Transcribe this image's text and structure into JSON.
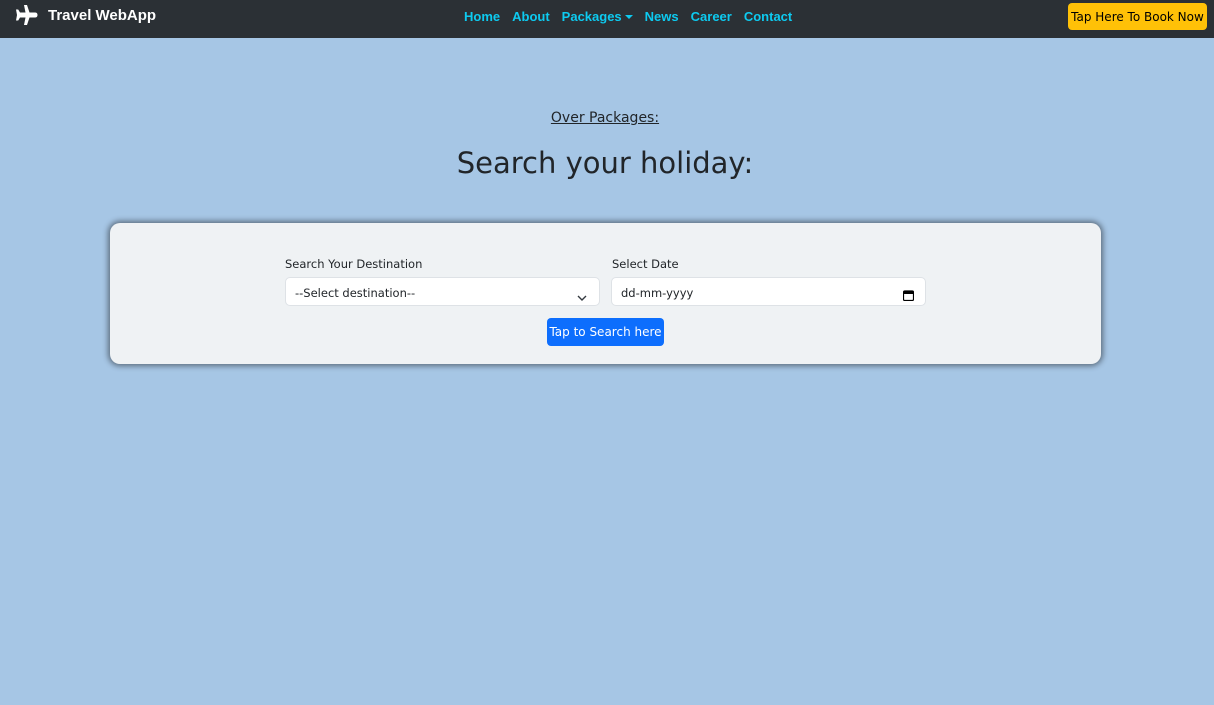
{
  "navbar": {
    "brand": "Travel WebApp",
    "brand_icon": "airplane-icon",
    "links": [
      {
        "label": "Home"
      },
      {
        "label": "About"
      },
      {
        "label": "Packages",
        "dropdown": true
      },
      {
        "label": "News"
      },
      {
        "label": "Career"
      },
      {
        "label": "Contact"
      }
    ],
    "book_button": "Tap Here To Book Now"
  },
  "main": {
    "subheading": "Over Packages:",
    "heading": "Search your holiday:"
  },
  "search_form": {
    "destination_label": "Search Your Destination",
    "destination_value": "--Select destination--",
    "date_label": "Select Date",
    "date_placeholder": "dd-mm-yyyy",
    "submit_label": "Tap to Search here"
  },
  "colors": {
    "page_bg": "#a6c6e5",
    "navbar_bg": "#2b3035",
    "nav_link": "#0dcaf0",
    "book_button_bg": "#ffc107",
    "search_button_bg": "#0d6efd",
    "card_bg": "#eff2f4"
  }
}
